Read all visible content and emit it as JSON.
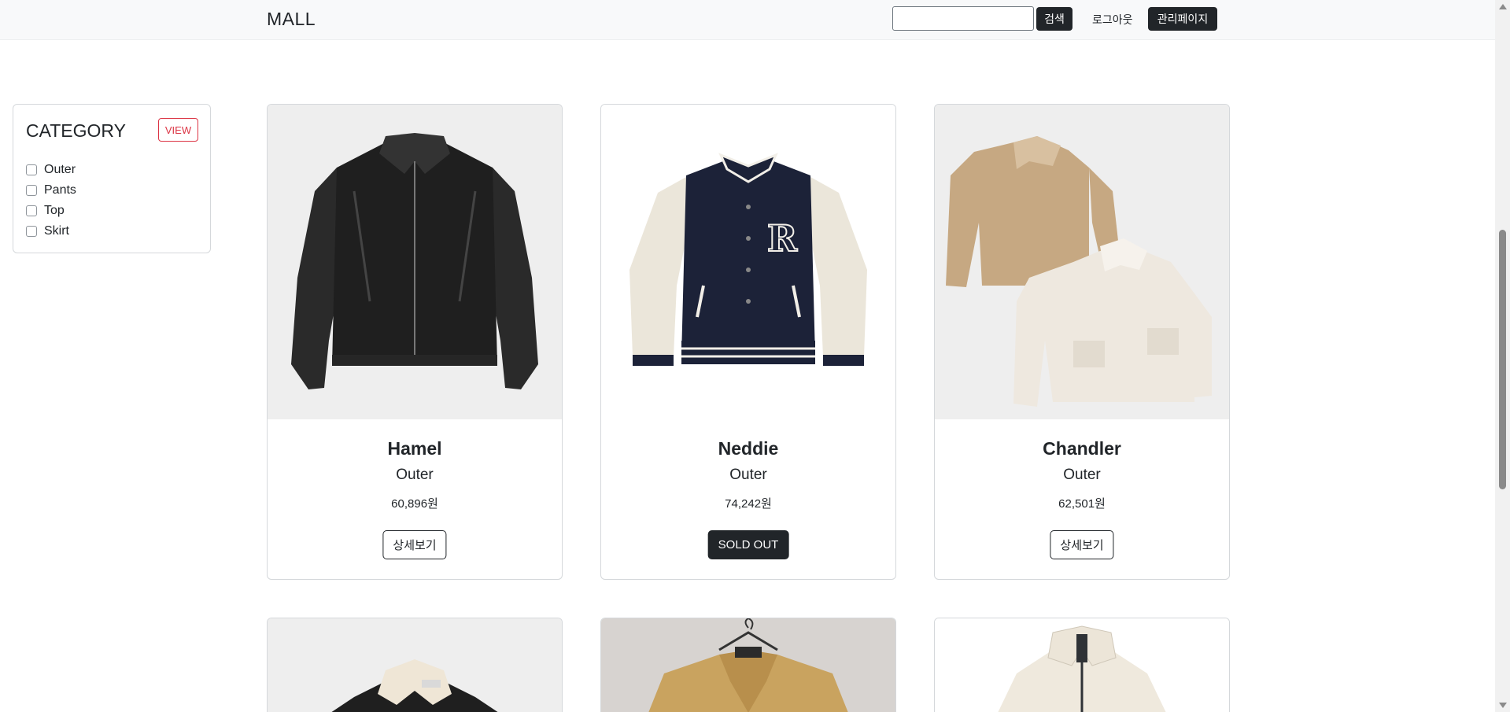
{
  "navbar": {
    "brand": "MALL",
    "search_value": "",
    "search_button": "검색",
    "logout_link": "로그아웃",
    "admin_button": "관리페이지"
  },
  "category": {
    "title": "CATEGORY",
    "view_button": "VIEW",
    "items": [
      {
        "label": "Outer",
        "checked": false
      },
      {
        "label": "Pants",
        "checked": false
      },
      {
        "label": "Top",
        "checked": false
      },
      {
        "label": "Skirt",
        "checked": false
      }
    ]
  },
  "products": [
    {
      "name": "Hamel",
      "category": "Outer",
      "price": "60,896원",
      "button": "상세보기",
      "image_icon": "leather-jacket-icon"
    },
    {
      "name": "Neddie",
      "category": "Outer",
      "price": "74,242원",
      "button": "SOLD OUT",
      "image_icon": "varsity-jacket-icon"
    },
    {
      "name": "Chandler",
      "category": "Outer",
      "price": "62,501원",
      "button": "상세보기",
      "image_icon": "shearling-jackets-icon"
    },
    {
      "image_icon": "shearling-collar-jacket-icon"
    },
    {
      "image_icon": "camel-coat-icon"
    },
    {
      "image_icon": "fleece-jacket-icon"
    }
  ],
  "colors": {
    "navbar_bg": "#f8f9fa",
    "dark": "#212529",
    "view_red": "#dc3545"
  }
}
